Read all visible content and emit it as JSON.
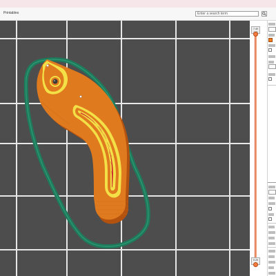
{
  "window": {
    "tab_label": "Printables"
  },
  "search": {
    "placeholder": "Enter a search term"
  },
  "layer_slider": {
    "upper": {
      "height": "7.40",
      "layer": "(37)"
    },
    "lower": {
      "height": "0.20",
      "layer": "(1)"
    }
  },
  "colors": {
    "accent": "#f57c1f",
    "viewport_bg": "#4d4d4d",
    "grid_line": "#e6e6e6",
    "skirt": "#1f7a5c",
    "perimeter": "#e07a1f",
    "infill": "#d02e2e",
    "inner_perimeter": "#f2e046"
  },
  "icons": {
    "search": "search-icon",
    "slider_thumb": "circle"
  }
}
